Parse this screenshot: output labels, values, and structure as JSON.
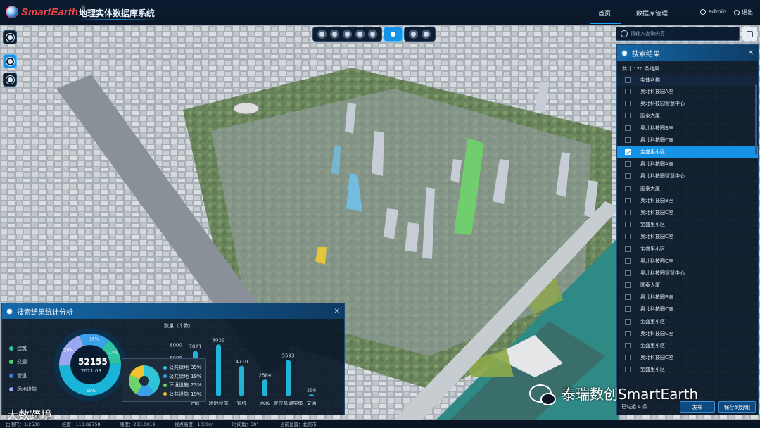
{
  "header": {
    "logo_text": "SmartEarth",
    "logo_reg": "®",
    "system_title": "地理实体数据库系统",
    "nav": [
      {
        "label": "首页",
        "active": true
      },
      {
        "label": "数据库管理",
        "active": false
      }
    ],
    "user": "admin",
    "logout": "退出"
  },
  "search": {
    "placeholder": "请输入查询内容"
  },
  "results": {
    "title": "搜索结果",
    "total_text": "共计 120 条结果",
    "column_header": "实体名称",
    "rows": [
      "奥北科技园A座",
      "奥北科技园智慧中心",
      "国泰大厦",
      "奥北科技园B座",
      "奥北科技园C座",
      "宝盛里小区",
      "奥北科技园A座",
      "奥北科技园智慧中心",
      "国泰大厦",
      "奥北科技园B座",
      "奥北科技园C座",
      "宝盛里小区",
      "奥北科技园C座",
      "宝盛里小区",
      "奥北科技园C座",
      "奥北科技园智慧中心",
      "国泰大厦",
      "奥北科技园B座",
      "奥北科技园C座",
      "宝盛里小区",
      "奥北科技园C座",
      "宝盛里小区",
      "奥北科技园C座",
      "宝盛里小区"
    ],
    "selected_index": 5,
    "selected_text": "已勾选 4 条",
    "publish_label": "发布",
    "save_group_label": "保存到分组"
  },
  "stats": {
    "title": "搜索结果统计分析",
    "legend": [
      {
        "label": "建筑",
        "color": "#2ec4a0"
      },
      {
        "label": "交通",
        "color": "#4fd36b"
      },
      {
        "label": "管道",
        "color": "#3d7de0"
      },
      {
        "label": "场地设施",
        "color": "#9aa6f0"
      }
    ],
    "total_value": "52155",
    "date": "2021.09",
    "popup": [
      {
        "label": "公共绿地",
        "percent": "39%",
        "color": "#31c3d8"
      },
      {
        "label": "公共绿地",
        "percent": "19%",
        "color": "#37a2e8"
      },
      {
        "label": "环境设施",
        "percent": "23%",
        "color": "#6fd36d"
      },
      {
        "label": "公共设施",
        "percent": "19%",
        "color": "#f1c232"
      }
    ]
  },
  "chart_data": {
    "type": "bar",
    "ylabel": "数量（个数）",
    "y_ticks": [
      6000,
      8000
    ],
    "categories": [
      "",
      "场地设施",
      "管线",
      "水系",
      "定位基础实体",
      "交通"
    ],
    "values": [
      7021,
      8029,
      4710,
      2584,
      5593,
      298
    ],
    "first_category_partial": "md",
    "ylim": [
      0,
      8500
    ],
    "donut": {
      "slices": [
        {
          "label": "16%",
          "value": 16
        },
        {
          "label": "14%",
          "value": 14
        },
        {
          "label": "50%",
          "value": 50
        },
        {
          "label": "20%",
          "value": 20
        }
      ]
    }
  },
  "status": {
    "scale": "比例尺：1:2530",
    "lon": "经度：113.82758",
    "lat": "纬度：283.0019",
    "view_height": "视点高度：1039m",
    "time": "时间角：38°",
    "location": "当前位置：北京市"
  },
  "watermark": "泰瑞数创SmartEarth",
  "watermark2": "大数跨境"
}
